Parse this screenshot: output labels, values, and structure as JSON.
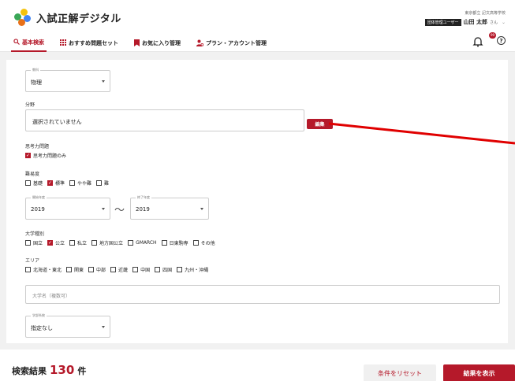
{
  "header": {
    "app_title": "入試正解デジタル",
    "school": "東京都立 記文高等学校",
    "role": "団体管理ユーザー",
    "user_name": "山田 太郎",
    "honorific": "さん",
    "notification_count": "99",
    "help_glyph": "?"
  },
  "nav": [
    {
      "label": "基本検索",
      "icon": "search-icon"
    },
    {
      "label": "おすすめ問題セット",
      "icon": "grid-icon"
    },
    {
      "label": "お気に入り管理",
      "icon": "bookmark-icon"
    },
    {
      "label": "プラン・アカウント管理",
      "icon": "user-settings-icon"
    }
  ],
  "form": {
    "subject": {
      "legend": "教科",
      "value": "物理"
    },
    "field": {
      "label": "分野",
      "value": "選択されていません",
      "edit_label": "編集"
    },
    "thinking": {
      "label": "思考力問題",
      "option": "思考力問題のみ",
      "checked": true
    },
    "difficulty": {
      "label": "難易度",
      "options": [
        {
          "label": "基礎",
          "checked": false
        },
        {
          "label": "標準",
          "checked": true
        },
        {
          "label": "やや難",
          "checked": false
        },
        {
          "label": "難",
          "checked": false
        }
      ]
    },
    "year_start": {
      "legend": "開始年度",
      "value": "2019"
    },
    "year_sep": "〜",
    "year_end": {
      "legend": "終了年度",
      "value": "2019"
    },
    "univ_type": {
      "label": "大学種別",
      "options": [
        {
          "label": "国立",
          "checked": false
        },
        {
          "label": "公立",
          "checked": true
        },
        {
          "label": "私立",
          "checked": false
        },
        {
          "label": "地方国公立",
          "checked": false
        },
        {
          "label": "GMARCH",
          "checked": false
        },
        {
          "label": "日東駒専",
          "checked": false
        },
        {
          "label": "その他",
          "checked": false
        }
      ]
    },
    "area": {
      "label": "エリア",
      "options": [
        {
          "label": "北海道・東北",
          "checked": false
        },
        {
          "label": "関東",
          "checked": false
        },
        {
          "label": "中部",
          "checked": false
        },
        {
          "label": "近畿",
          "checked": false
        },
        {
          "label": "中国",
          "checked": false
        },
        {
          "label": "四国",
          "checked": false
        },
        {
          "label": "九州・沖縄",
          "checked": false
        }
      ]
    },
    "univ_name": {
      "placeholder": "大学名（複数可）"
    },
    "dept": {
      "legend": "学部系統",
      "value": "指定なし"
    }
  },
  "footer": {
    "result_label": "検索結果",
    "result_count": "130",
    "result_unit": "件",
    "reset_label": "条件をリセット",
    "show_label": "結果を表示"
  },
  "colors": {
    "accent": "#b5192a",
    "annotation": "#e00000"
  }
}
